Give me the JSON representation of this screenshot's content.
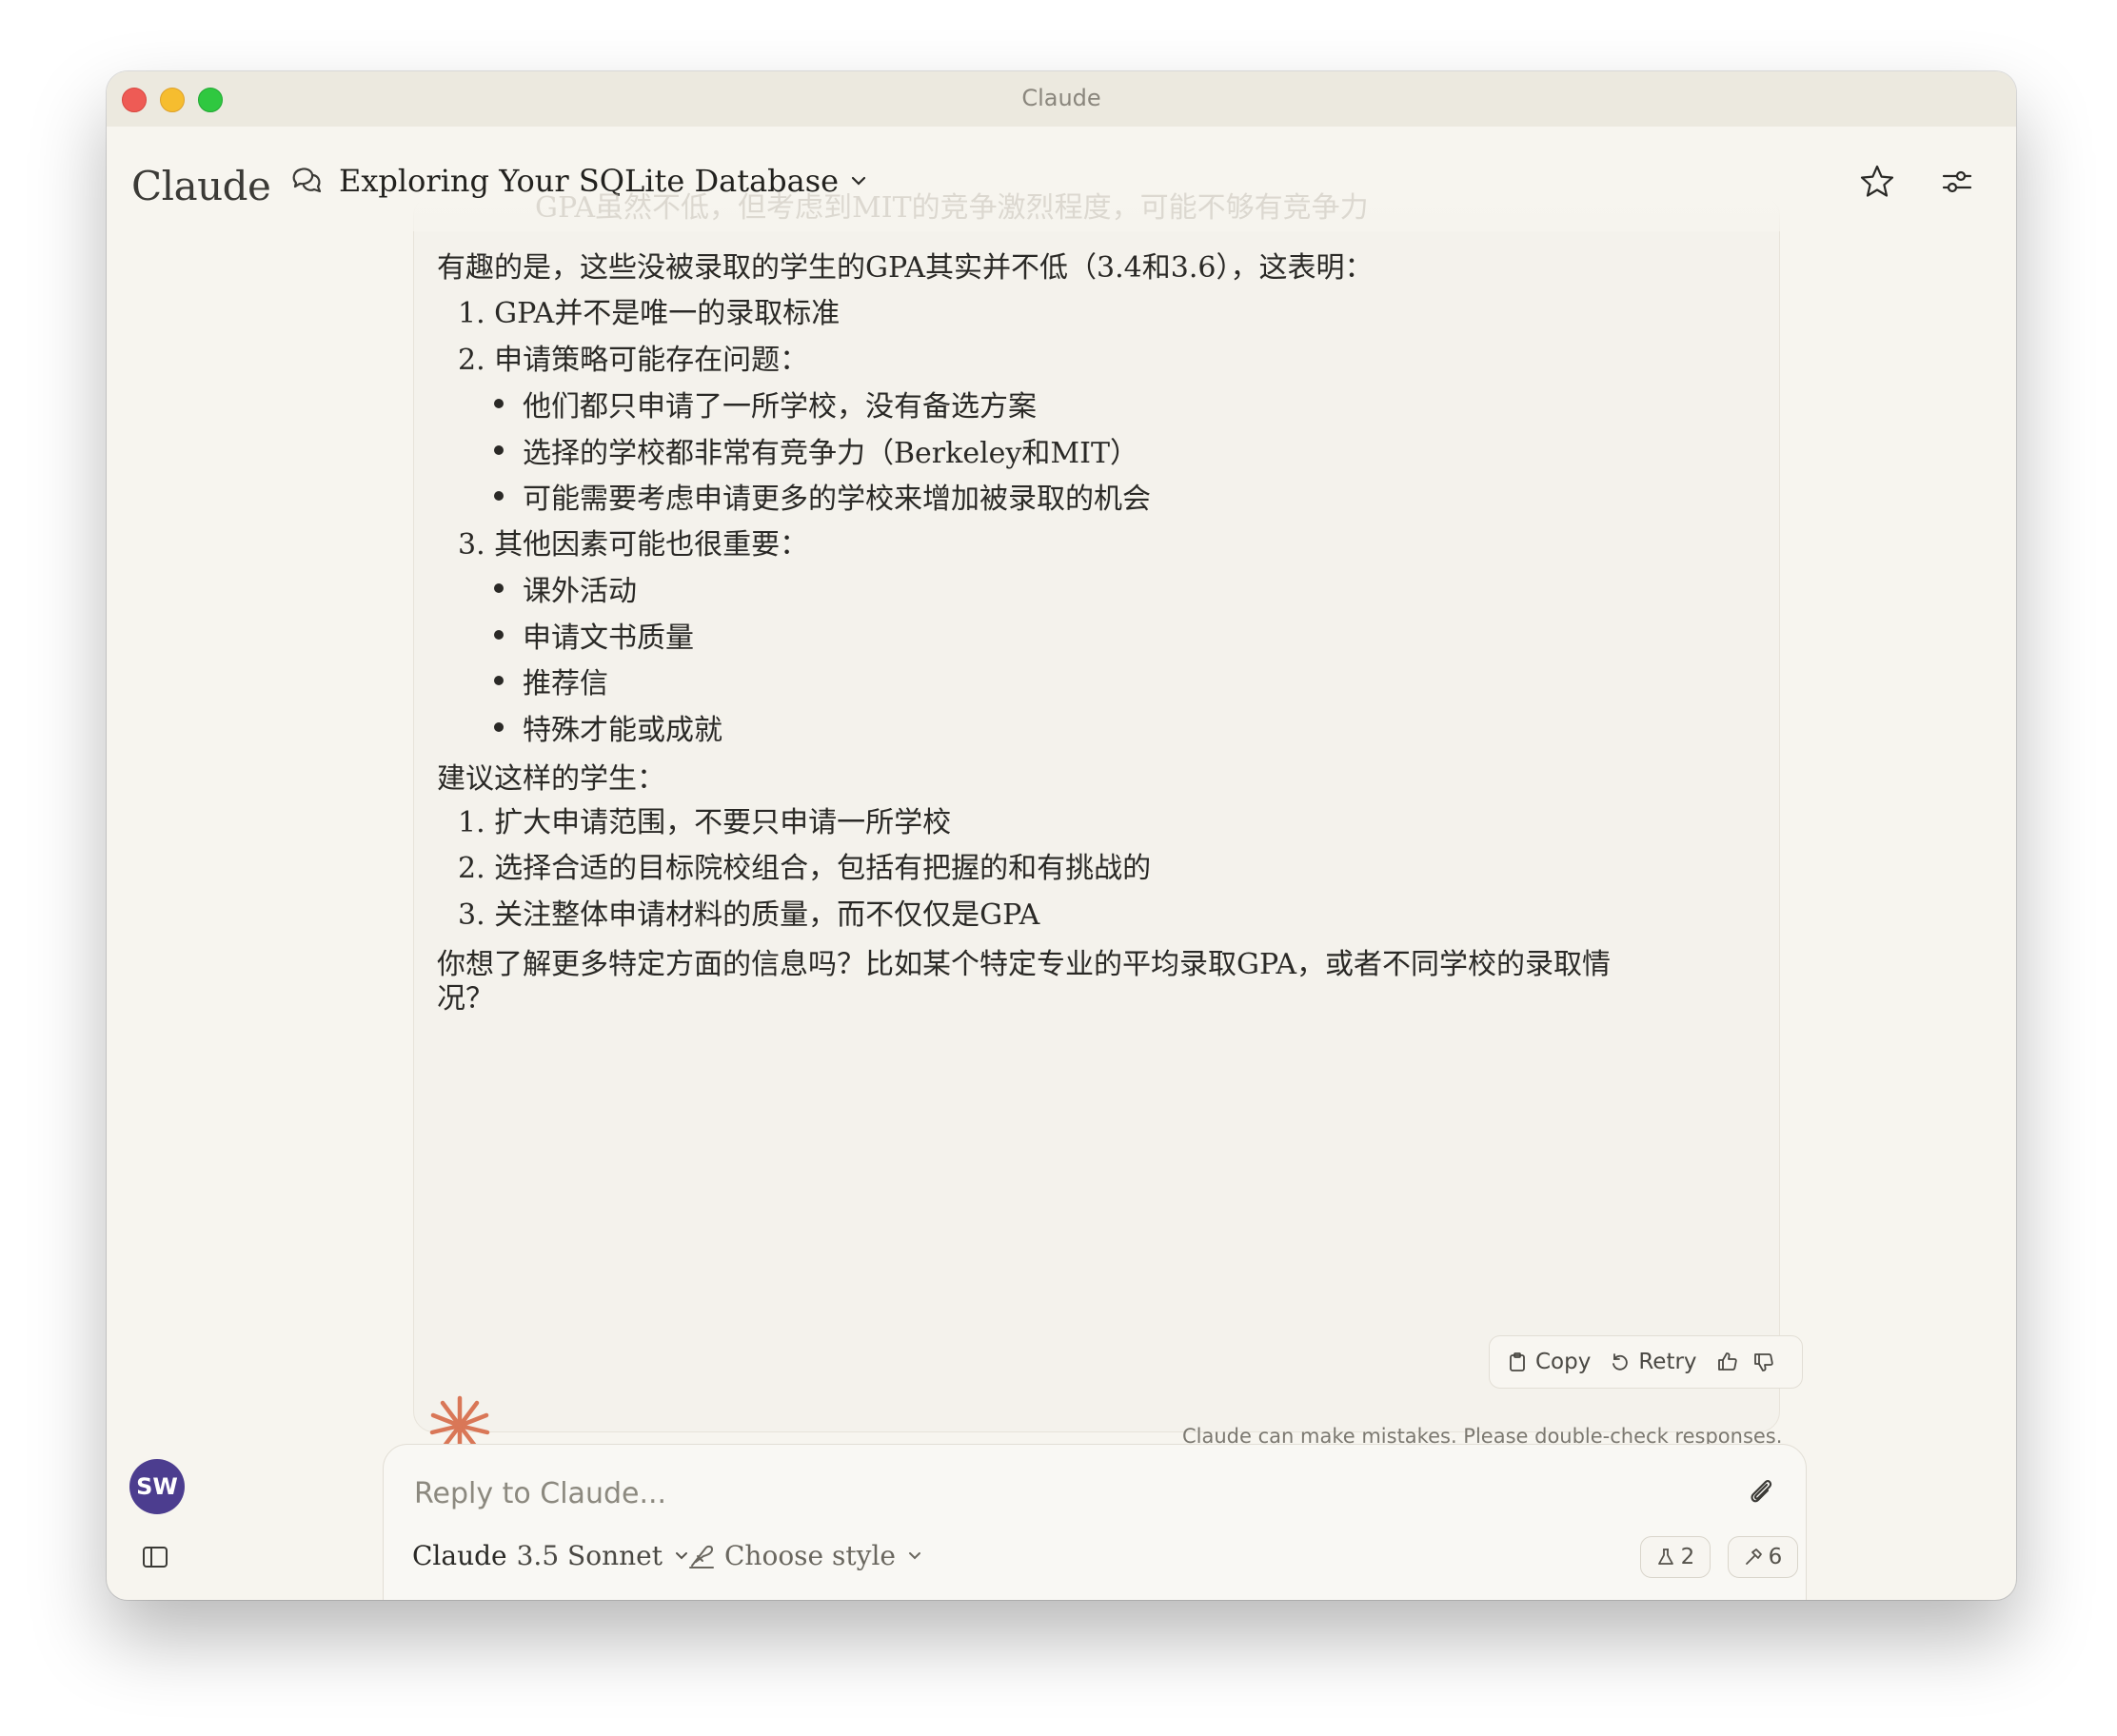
{
  "window": {
    "title": "Claude"
  },
  "header": {
    "logo": "Claude",
    "chat_title": "Exploring Your SQLite Database"
  },
  "message": {
    "faded_top_line": "GPA虽然不低，但考虑到MIT的竞争激烈程度，可能不够有竞争力",
    "intro": "有趣的是，这些没被录取的学生的GPA其实并不低（3.4和3.6），这表明：",
    "points": [
      {
        "num": "1.",
        "text": "GPA并不是唯一的录取标准"
      },
      {
        "num": "2.",
        "text": "申请策略可能存在问题："
      },
      {
        "num": "3.",
        "text": "其他因素可能也很重要："
      }
    ],
    "strategy_bullets": [
      "他们都只申请了一所学校，没有备选方案",
      "选择的学校都非常有竞争力（Berkeley和MIT）",
      "可能需要考虑申请更多的学校来增加被录取的机会"
    ],
    "factor_bullets": [
      "课外活动",
      "申请文书质量",
      "推荐信",
      "特殊才能或成就"
    ],
    "advice_heading": "建议这样的学生：",
    "advice": [
      {
        "num": "1.",
        "text": "扩大申请范围，不要只申请一所学校"
      },
      {
        "num": "2.",
        "text": "选择合适的目标院校组合，包括有把握的和有挑战的"
      },
      {
        "num": "3.",
        "text": "关注整体申请材料的质量，而不仅仅是GPA"
      }
    ],
    "closing_line1": "你想了解更多特定方面的信息吗？比如某个特定专业的平均录取GPA，或者不同学校的录取情",
    "closing_line2": "况？"
  },
  "actions": {
    "copy": "Copy",
    "retry": "Retry"
  },
  "disclaimer": "Claude can make mistakes. Please double-check responses.",
  "composer": {
    "placeholder": "Reply to Claude...",
    "model_name": "Claude",
    "model_version": "3.5 Sonnet",
    "style_label": "Choose style",
    "flask_count": "2",
    "tools_count": "6"
  },
  "user": {
    "initials": "SW"
  },
  "colors": {
    "accent": "#d97757",
    "avatar": "#4c3d8f"
  }
}
